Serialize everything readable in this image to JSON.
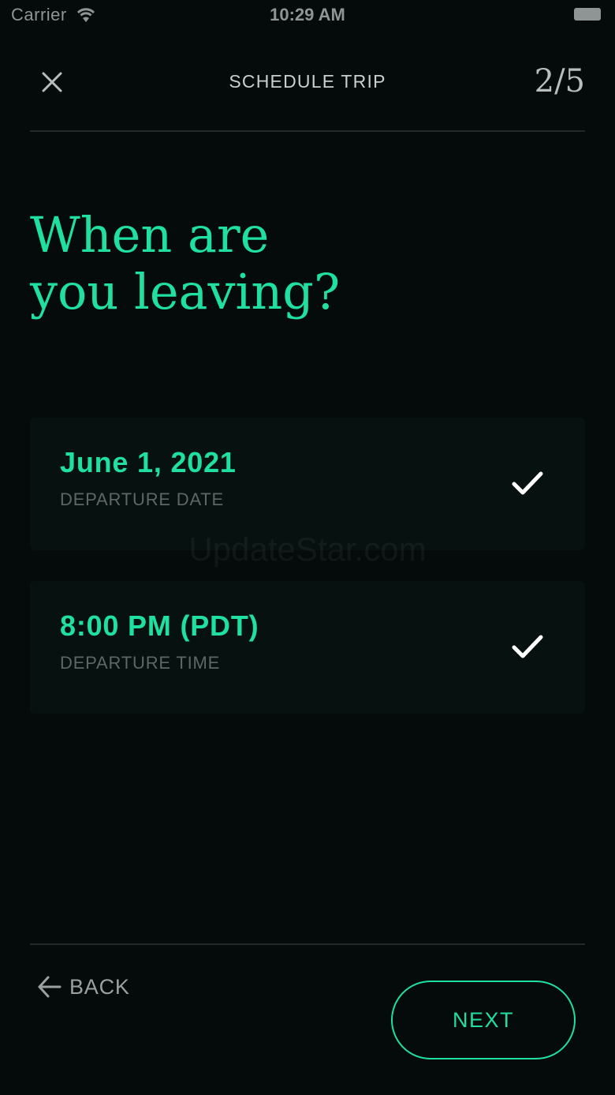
{
  "status_bar": {
    "carrier": "Carrier",
    "time": "10:29 AM",
    "wifi_icon": "wifi-icon",
    "battery_icon": "battery-icon"
  },
  "header": {
    "close_icon": "close-icon",
    "title": "SCHEDULE TRIP",
    "step": "2/5"
  },
  "heading": {
    "line1": "When are",
    "line2": "you leaving?"
  },
  "options": [
    {
      "value": "June 1, 2021",
      "label": "DEPARTURE DATE",
      "icon": "check-icon",
      "selected": true
    },
    {
      "value": "8:00 PM (PDT)",
      "label": "DEPARTURE TIME",
      "icon": "check-icon",
      "selected": true
    }
  ],
  "watermark": "UpdateStar.com",
  "footer": {
    "back_label": "BACK",
    "back_icon": "arrow-left-icon",
    "next_label": "NEXT"
  },
  "colors": {
    "background": "#050a0b",
    "accent": "#1fe0a0",
    "card": "#07110f",
    "muted_text": "#5f6766"
  }
}
